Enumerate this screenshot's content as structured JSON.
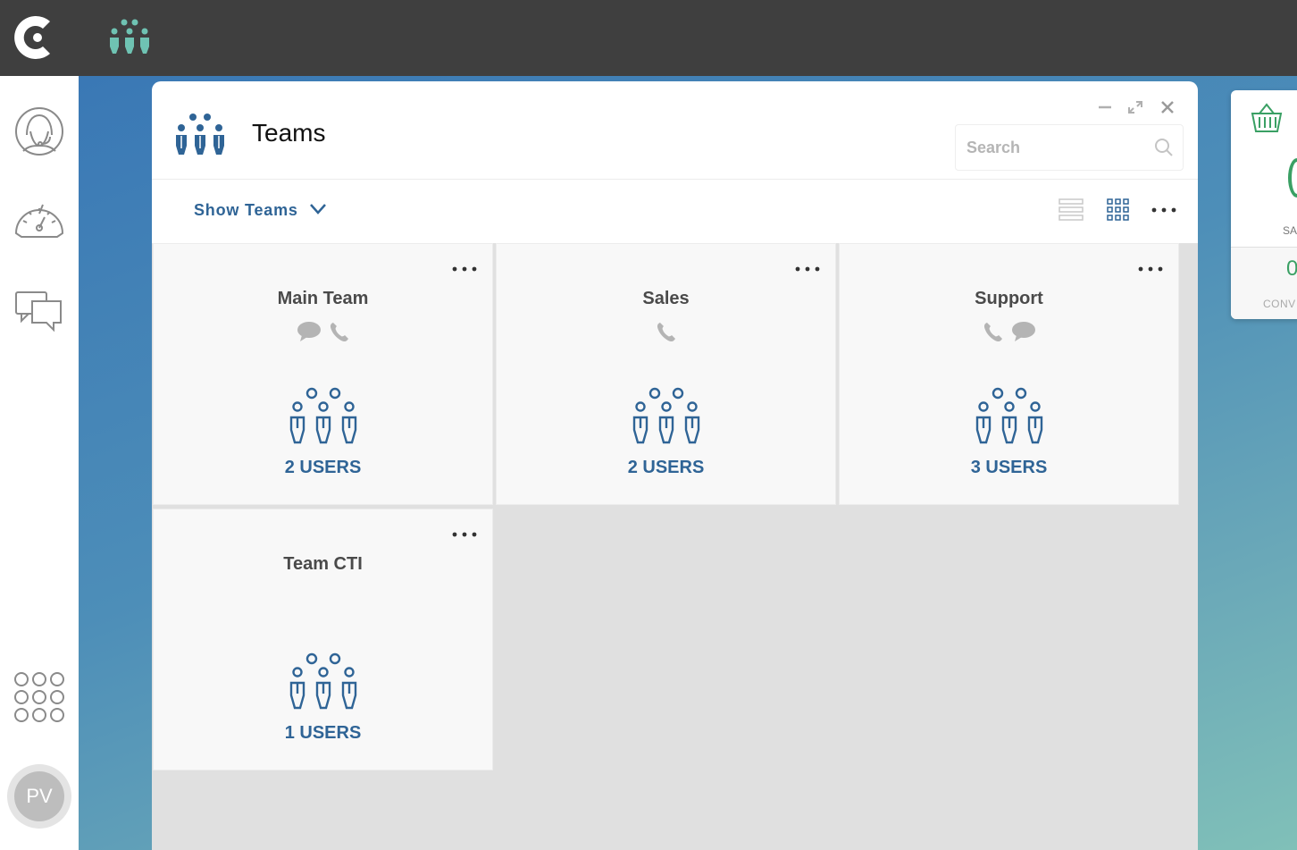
{
  "app": {
    "user_initials": "PV"
  },
  "window": {
    "title": "Teams",
    "search_placeholder": "Search"
  },
  "toolbar": {
    "show_label": "Show Teams"
  },
  "side_widget": {
    "label_top": "SA",
    "value_bottom": "0",
    "label_bottom": "CONV"
  },
  "teams": [
    {
      "name": "Main Team",
      "channels": [
        "chat-icon",
        "phone-icon"
      ],
      "users_label": "2 USERS"
    },
    {
      "name": "Sales",
      "channels": [
        "phone-icon"
      ],
      "users_label": "2 USERS"
    },
    {
      "name": "Support",
      "channels": [
        "phone-icon",
        "chat-icon"
      ],
      "users_label": "3 USERS"
    },
    {
      "name": "Team CTI",
      "channels": [],
      "users_label": "1 USERS"
    }
  ],
  "colors": {
    "accent_blue": "#2f6496",
    "team_icon_teal": "#6fc3b3",
    "widget_green": "#3aa064",
    "topbar": "#3f3f3f"
  }
}
